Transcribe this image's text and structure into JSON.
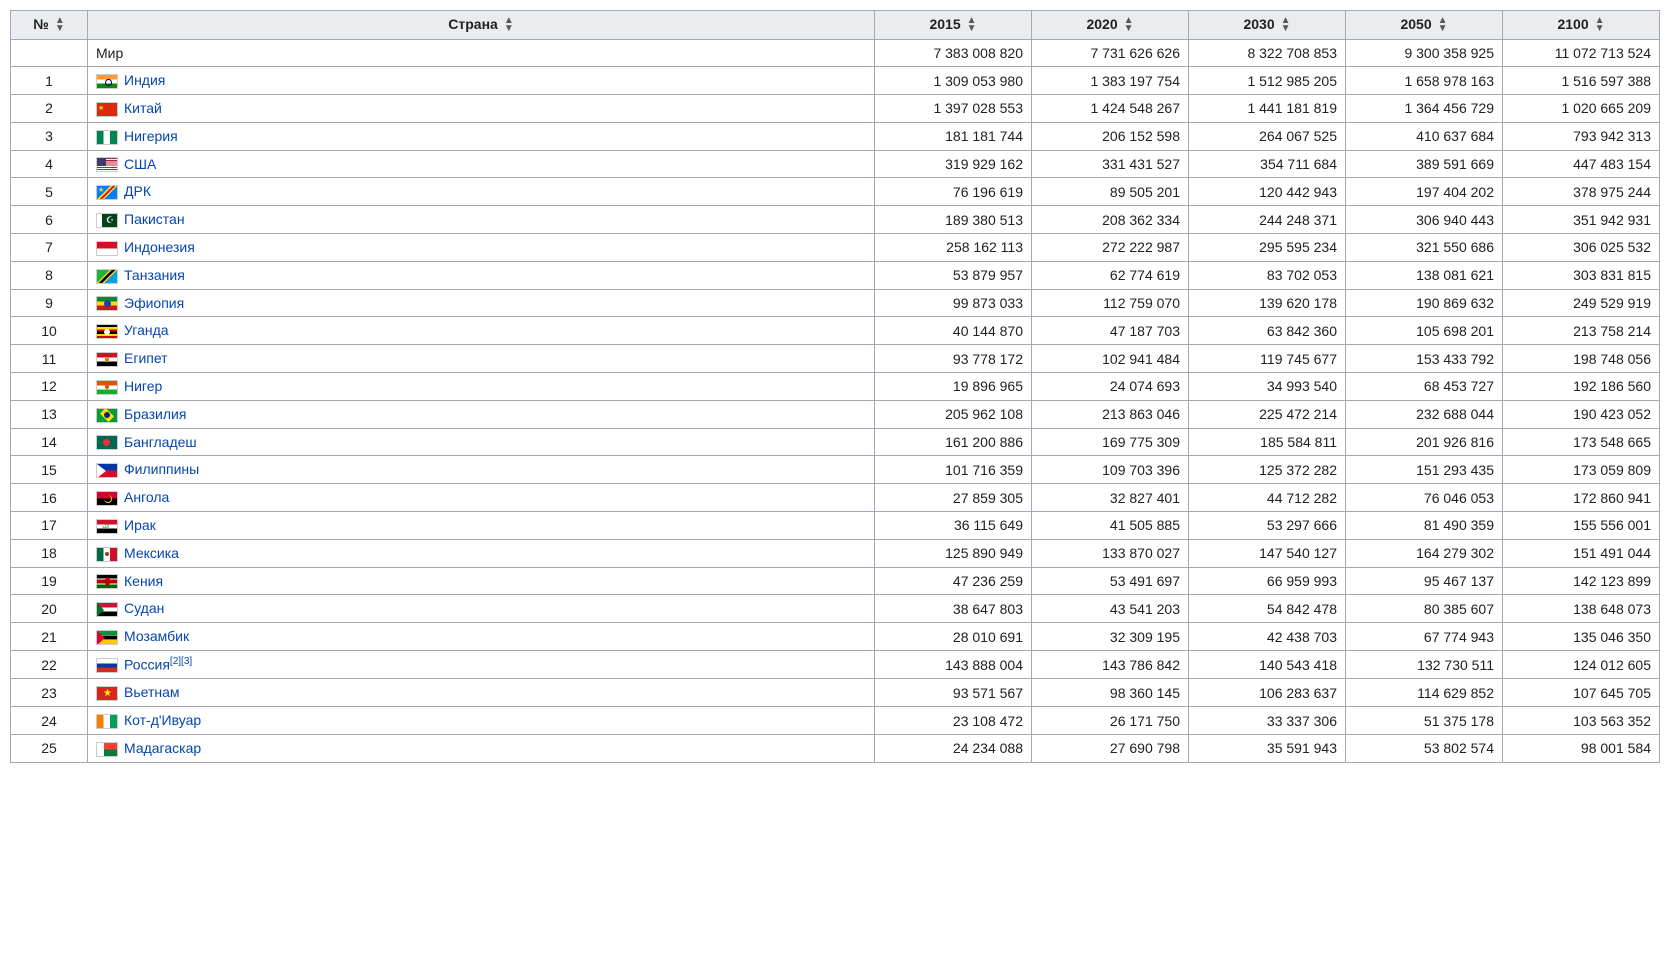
{
  "headers": {
    "num": "№",
    "country": "Страна",
    "y2015": "2015",
    "y2020": "2020",
    "y2030": "2030",
    "y2050": "2050",
    "y2100": "2100"
  },
  "world_row": {
    "label": "Мир",
    "y2015": "7 383 008 820",
    "y2020": "7 731 626 626",
    "y2030": "8 322 708 853",
    "y2050": "9 300 358 925",
    "y2100": "11 072 713 524"
  },
  "rows": [
    {
      "n": "1",
      "flag": "india",
      "name": "Индия",
      "y2015": "1 309 053 980",
      "y2020": "1 383 197 754",
      "y2030": "1 512 985 205",
      "y2050": "1 658 978 163",
      "y2100": "1 516 597 388"
    },
    {
      "n": "2",
      "flag": "china",
      "name": "Китай",
      "y2015": "1 397 028 553",
      "y2020": "1 424 548 267",
      "y2030": "1 441 181 819",
      "y2050": "1 364 456 729",
      "y2100": "1 020 665 209"
    },
    {
      "n": "3",
      "flag": "nigeria",
      "name": "Нигерия",
      "y2015": "181 181 744",
      "y2020": "206 152 598",
      "y2030": "264 067 525",
      "y2050": "410 637 684",
      "y2100": "793 942 313"
    },
    {
      "n": "4",
      "flag": "usa",
      "name": "США",
      "y2015": "319 929 162",
      "y2020": "331 431 527",
      "y2030": "354 711 684",
      "y2050": "389 591 669",
      "y2100": "447 483 154"
    },
    {
      "n": "5",
      "flag": "drc",
      "name": "ДРК",
      "y2015": "76 196 619",
      "y2020": "89 505 201",
      "y2030": "120 442 943",
      "y2050": "197 404 202",
      "y2100": "378 975 244"
    },
    {
      "n": "6",
      "flag": "pakistan",
      "name": "Пакистан",
      "y2015": "189 380 513",
      "y2020": "208 362 334",
      "y2030": "244 248 371",
      "y2050": "306 940 443",
      "y2100": "351 942 931"
    },
    {
      "n": "7",
      "flag": "indonesia",
      "name": "Индонезия",
      "y2015": "258 162 113",
      "y2020": "272 222 987",
      "y2030": "295 595 234",
      "y2050": "321 550 686",
      "y2100": "306 025 532"
    },
    {
      "n": "8",
      "flag": "tanzania",
      "name": "Танзания",
      "y2015": "53 879 957",
      "y2020": "62 774 619",
      "y2030": "83 702 053",
      "y2050": "138 081 621",
      "y2100": "303 831 815"
    },
    {
      "n": "9",
      "flag": "ethiopia",
      "name": "Эфиопия",
      "y2015": "99 873 033",
      "y2020": "112 759 070",
      "y2030": "139 620 178",
      "y2050": "190 869 632",
      "y2100": "249 529 919"
    },
    {
      "n": "10",
      "flag": "uganda",
      "name": "Уганда",
      "y2015": "40 144 870",
      "y2020": "47 187 703",
      "y2030": "63 842 360",
      "y2050": "105 698 201",
      "y2100": "213 758 214"
    },
    {
      "n": "11",
      "flag": "egypt",
      "name": "Египет",
      "y2015": "93 778 172",
      "y2020": "102 941 484",
      "y2030": "119 745 677",
      "y2050": "153 433 792",
      "y2100": "198 748 056"
    },
    {
      "n": "12",
      "flag": "niger",
      "name": "Нигер",
      "y2015": "19 896 965",
      "y2020": "24 074 693",
      "y2030": "34 993 540",
      "y2050": "68 453 727",
      "y2100": "192 186 560"
    },
    {
      "n": "13",
      "flag": "brazil",
      "name": "Бразилия",
      "y2015": "205 962 108",
      "y2020": "213 863 046",
      "y2030": "225 472 214",
      "y2050": "232 688 044",
      "y2100": "190 423 052"
    },
    {
      "n": "14",
      "flag": "bangladesh",
      "name": "Бангладеш",
      "y2015": "161 200 886",
      "y2020": "169 775 309",
      "y2030": "185 584 811",
      "y2050": "201 926 816",
      "y2100": "173 548 665"
    },
    {
      "n": "15",
      "flag": "philippines",
      "name": "Филиппины",
      "y2015": "101 716 359",
      "y2020": "109 703 396",
      "y2030": "125 372 282",
      "y2050": "151 293 435",
      "y2100": "173 059 809"
    },
    {
      "n": "16",
      "flag": "angola",
      "name": "Ангола",
      "y2015": "27 859 305",
      "y2020": "32 827 401",
      "y2030": "44 712 282",
      "y2050": "76 046 053",
      "y2100": "172 860 941"
    },
    {
      "n": "17",
      "flag": "iraq",
      "name": "Ирак",
      "y2015": "36 115 649",
      "y2020": "41 505 885",
      "y2030": "53 297 666",
      "y2050": "81 490 359",
      "y2100": "155 556 001"
    },
    {
      "n": "18",
      "flag": "mexico",
      "name": "Мексика",
      "y2015": "125 890 949",
      "y2020": "133 870 027",
      "y2030": "147 540 127",
      "y2050": "164 279 302",
      "y2100": "151 491 044"
    },
    {
      "n": "19",
      "flag": "kenya",
      "name": "Кения",
      "y2015": "47 236 259",
      "y2020": "53 491 697",
      "y2030": "66 959 993",
      "y2050": "95 467 137",
      "y2100": "142 123 899"
    },
    {
      "n": "20",
      "flag": "sudan",
      "name": "Судан",
      "y2015": "38 647 803",
      "y2020": "43 541 203",
      "y2030": "54 842 478",
      "y2050": "80 385 607",
      "y2100": "138 648 073"
    },
    {
      "n": "21",
      "flag": "mozambique",
      "name": "Мозамбик",
      "y2015": "28 010 691",
      "y2020": "32 309 195",
      "y2030": "42 438 703",
      "y2050": "67 774 943",
      "y2100": "135 046 350"
    },
    {
      "n": "22",
      "flag": "russia",
      "name": "Россия",
      "refs": "[2][3]",
      "y2015": "143 888 004",
      "y2020": "143 786 842",
      "y2030": "140 543 418",
      "y2050": "132 730 511",
      "y2100": "124 012 605"
    },
    {
      "n": "23",
      "flag": "vietnam",
      "name": "Вьетнам",
      "y2015": "93 571 567",
      "y2020": "98 360 145",
      "y2030": "106 283 637",
      "y2050": "114 629 852",
      "y2100": "107 645 705"
    },
    {
      "n": "24",
      "flag": "cotedivoire",
      "name": "Кот-д'Ивуар",
      "y2015": "23 108 472",
      "y2020": "26 171 750",
      "y2030": "33 337 306",
      "y2050": "51 375 178",
      "y2100": "103 563 352"
    },
    {
      "n": "25",
      "flag": "madagascar",
      "name": "Мадагаскар",
      "y2015": "24 234 088",
      "y2020": "27 690 798",
      "y2030": "35 591 943",
      "y2050": "53 802 574",
      "y2100": "98 001 584"
    }
  ]
}
